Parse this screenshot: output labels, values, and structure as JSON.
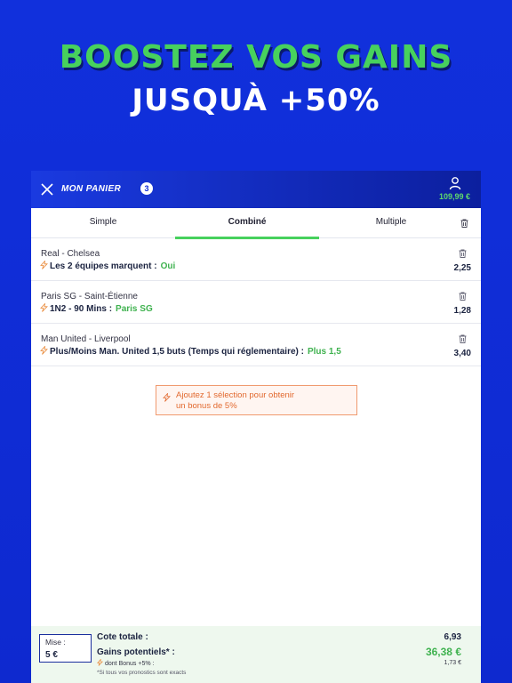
{
  "hero": {
    "line1": "BOOSTEZ VOS GAINS",
    "line2": "JUSQUÀ +50%"
  },
  "header": {
    "title": "MON PANIER",
    "count": "3",
    "balance": "109,99 €"
  },
  "tabs": [
    {
      "label": "Simple"
    },
    {
      "label": "Combiné"
    },
    {
      "label": "Multiple"
    }
  ],
  "selections": [
    {
      "match": "Real - Chelsea",
      "market": "Les 2 équipes marquent :",
      "pick": "Oui",
      "odds": "2,25"
    },
    {
      "match": "Paris SG - Saint-Étienne",
      "market": "1N2 - 90 Mins :",
      "pick": "Paris SG",
      "odds": "1,28"
    },
    {
      "match": "Man United - Liverpool",
      "market": "Plus/Moins Man. United 1,5 buts  (Temps qui réglementaire) :",
      "pick": "Plus 1,5",
      "odds": "3,40"
    }
  ],
  "bonus_message": {
    "line1": "Ajoutez 1 sélection pour obtenir",
    "line2": "un bonus de 5%"
  },
  "footer": {
    "stake_label": "Mise :",
    "stake_value": "5 €",
    "total_label": "Cote totale :",
    "total_value": "6,93",
    "gains_label": "Gains potentiels* :",
    "gains_value": "36,38 €",
    "bonus_label": "dont Bonus +5% :",
    "bonus_value": "1,73 €",
    "note": "*Si tous vos pronostics sont exacts"
  },
  "colors": {
    "background": "#0f2bd6",
    "accent_green": "#47d15d",
    "bonus_orange": "#e2692f"
  }
}
